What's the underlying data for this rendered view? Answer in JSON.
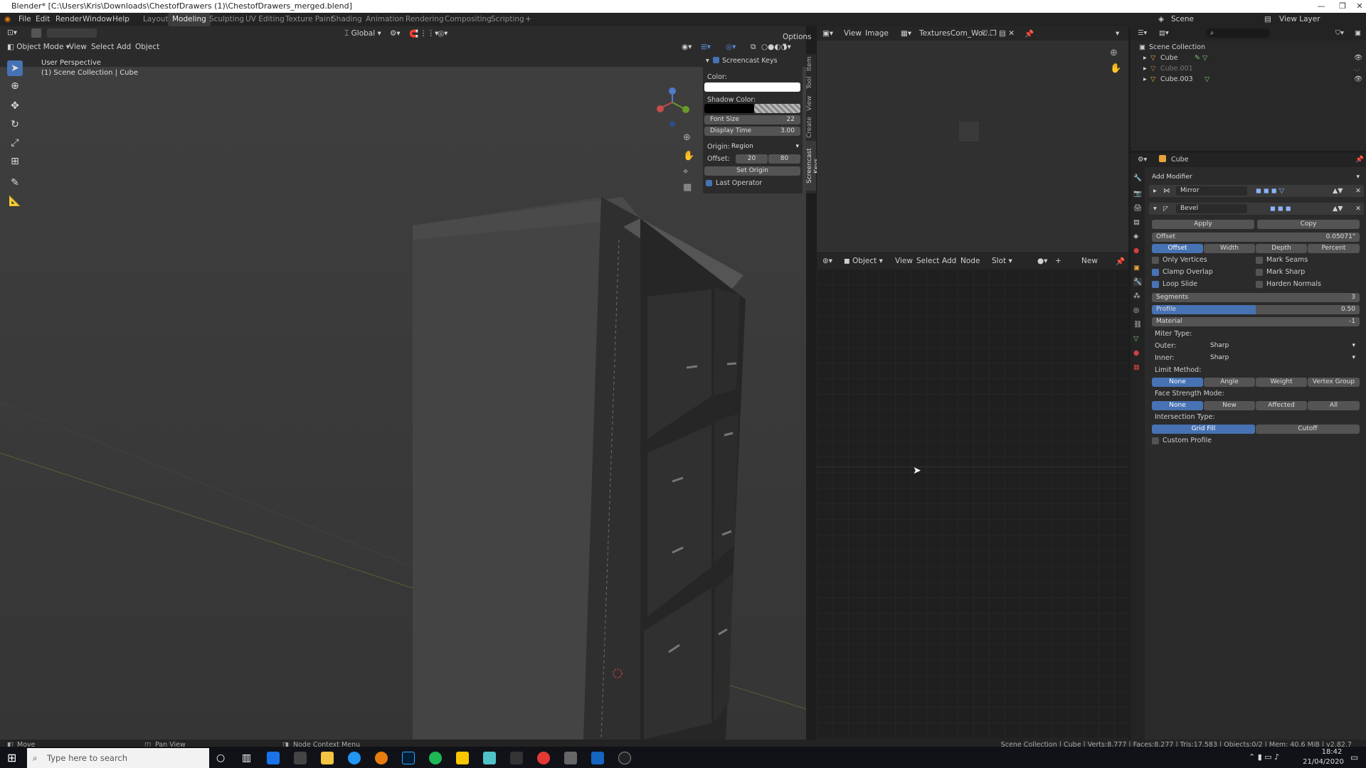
{
  "title_bar": {
    "title": "Blender* [C:\\Users\\Kris\\Downloads\\ChestofDrawers (1)\\ChestofDrawers_merged.blend]"
  },
  "menu": [
    "File",
    "Edit",
    "Render",
    "Window",
    "Help"
  ],
  "workspaces": [
    "Layout",
    "Modeling",
    "Sculpting",
    "UV Editing",
    "Texture Paint",
    "Shading",
    "Animation",
    "Rendering",
    "Compositing",
    "Scripting"
  ],
  "active_workspace": "Modeling",
  "scene": {
    "label": "Scene",
    "view_layer": "View Layer"
  },
  "viewport": {
    "mode": "Object Mode",
    "menu": [
      "View",
      "Select",
      "Add",
      "Object"
    ],
    "transform": "Global",
    "options": "Options",
    "overlay_title": "User Perspective",
    "overlay_sub": "(1) Scene Collection | Cube"
  },
  "screencast": {
    "title": "Screencast Keys",
    "color_label": "Color:",
    "shadow_label": "Shadow Color:",
    "font_size_label": "Font Size",
    "font_size": "22",
    "display_time_label": "Display Time",
    "display_time": "3.00",
    "origin_label": "Origin:",
    "origin": "Region",
    "offset_label": "Offset:",
    "offset_x": "20",
    "offset_y": "80",
    "set_origin": "Set Origin",
    "last_operator": "Last Operator",
    "tabs": [
      "Item",
      "Tool",
      "View",
      "Create",
      "Screencast Keys"
    ]
  },
  "image_editor": {
    "menu": [
      "View",
      "Image"
    ],
    "image_name": "TexturesCom_Wor..."
  },
  "node_editor": {
    "object": "Object",
    "menu": [
      "View",
      "Select",
      "Add",
      "Node"
    ],
    "slot": "Slot",
    "new": "New"
  },
  "outliner": {
    "root": "Scene Collection",
    "items": [
      "Cube",
      "Cube.001",
      "Cube.003"
    ]
  },
  "properties": {
    "object": "Cube",
    "add_modifier": "Add Modifier",
    "modifiers": [
      "Mirror",
      "Bevel"
    ],
    "apply": "Apply",
    "copy": "Copy",
    "offset_label": "Offset",
    "offset_value": "0.05071\"",
    "width_types": [
      "Offset",
      "Width",
      "Depth",
      "Percent"
    ],
    "checks_left": [
      "Only Vertices",
      "Clamp Overlap",
      "Loop Slide"
    ],
    "checks_left_on": [
      false,
      true,
      true
    ],
    "checks_right": [
      "Mark Seams",
      "Mark Sharp",
      "Harden Normals"
    ],
    "segments_label": "Segments",
    "segments": "3",
    "profile_label": "Profile",
    "profile": "0.50",
    "profile_fraction": 0.5,
    "material_label": "Material",
    "material": "-1",
    "miter_label": "Miter Type:",
    "outer_label": "Outer:",
    "outer": "Sharp",
    "inner_label": "Inner:",
    "inner": "Sharp",
    "limit_label": "Limit Method:",
    "limit": [
      "None",
      "Angle",
      "Weight",
      "Vertex Group"
    ],
    "face_label": "Face Strength Mode:",
    "face": [
      "None",
      "New",
      "Affected",
      "All"
    ],
    "intersection_label": "Intersection Type:",
    "intersection": [
      "Grid Fill",
      "Cutoff"
    ],
    "custom_profile": "Custom Profile"
  },
  "status": {
    "left1": "Move",
    "left2": "Pan View",
    "left3": "Node Context Menu",
    "right": "Scene Collection | Cube | Verts:8,777 | Faces:8,277 | Tris:17,583 | Objects:0/2 | Mem: 40.6 MiB | v2.82.7"
  },
  "taskbar": {
    "search": "Type here to search",
    "time": "18:42",
    "date": "21/04/2020"
  }
}
